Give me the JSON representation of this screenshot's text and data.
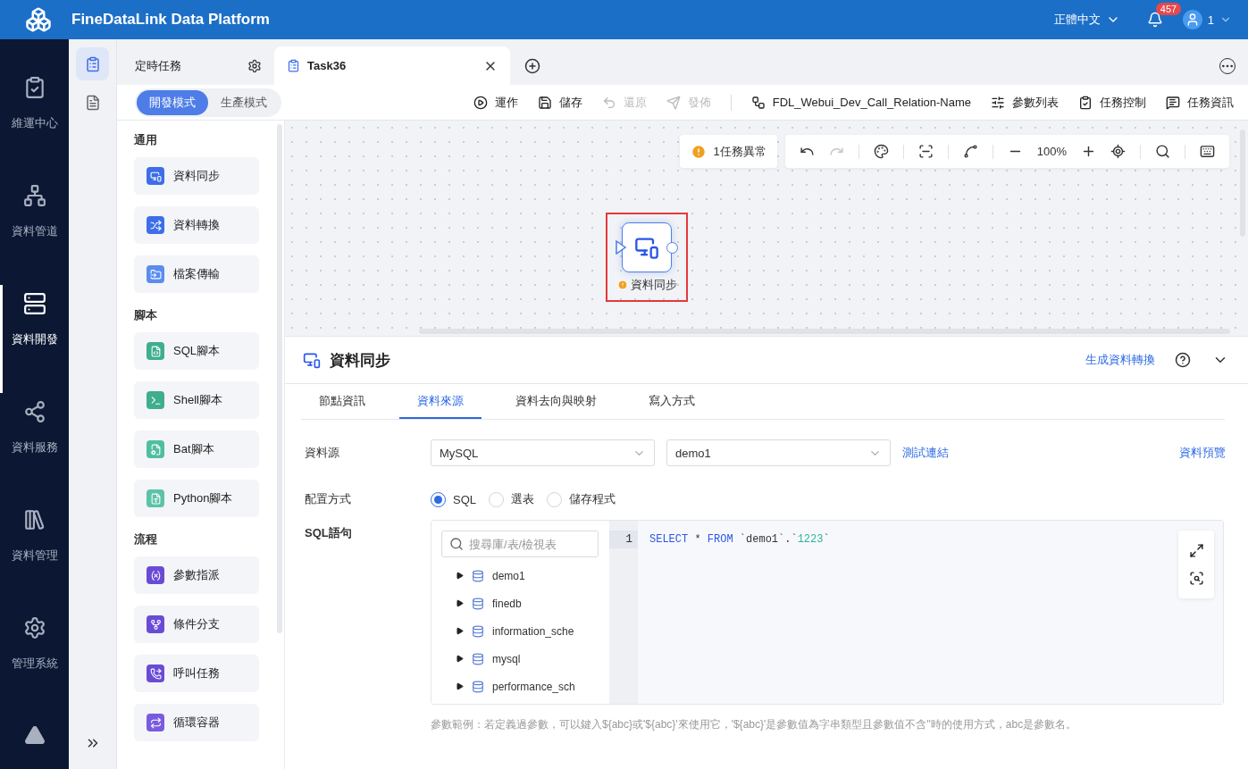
{
  "header": {
    "title": "FineDataLink Data Platform",
    "language": "正體中文",
    "notifications": "457",
    "user": "1"
  },
  "nav": {
    "items": [
      {
        "label": "維運中心",
        "selected": false
      },
      {
        "label": "資料管道",
        "selected": false
      },
      {
        "label": "資料開發",
        "selected": true
      },
      {
        "label": "資料服務",
        "selected": false
      },
      {
        "label": "資料管理",
        "selected": false
      },
      {
        "label": "管理系統",
        "selected": false
      }
    ]
  },
  "side_icons": [
    {
      "selected": true
    },
    {
      "selected": false
    }
  ],
  "tabs": [
    {
      "label": "定時任務",
      "kind": "settings",
      "selected": false
    },
    {
      "label": "Task36",
      "kind": "task",
      "selected": true
    }
  ],
  "modes": [
    {
      "label": "開發模式",
      "selected": true
    },
    {
      "label": "生產模式",
      "selected": false
    }
  ],
  "edit_actions": [
    {
      "label": "運作",
      "disabled": false
    },
    {
      "label": "儲存",
      "disabled": false
    },
    {
      "label": "還原",
      "disabled": true
    },
    {
      "label": "發佈",
      "disabled": true
    }
  ],
  "task_actions": [
    {
      "label": "FDL_Webui_Dev_Call_Relation-Name"
    },
    {
      "label": "參數列表"
    },
    {
      "label": "任務控制"
    },
    {
      "label": "任務資訊"
    }
  ],
  "palette": [
    {
      "title": "通用",
      "items": [
        "資料同步",
        "資料轉換",
        "檔案傳輸"
      ]
    },
    {
      "title": "腳本",
      "items": [
        "SQL腳本",
        "Shell腳本",
        "Bat腳本",
        "Python腳本"
      ]
    },
    {
      "title": "流程",
      "items": [
        "參數指派",
        "條件分支",
        "呼叫任務",
        "循環容器"
      ]
    }
  ],
  "canvas": {
    "alert": "1任務異常",
    "undo_redo": [
      {
        "disabled": false
      },
      {
        "disabled": true
      }
    ],
    "zoom": "100%",
    "node": {
      "label": "資料同步",
      "warning": true,
      "selected": true
    }
  },
  "panel": {
    "title": "資料同步",
    "link": "生成資料轉換",
    "tabs": [
      {
        "label": "節點資訊",
        "selected": false
      },
      {
        "label": "資料來源",
        "selected": true
      },
      {
        "label": "資料去向與映射",
        "selected": false
      },
      {
        "label": "寫入方式",
        "selected": false
      }
    ],
    "source": {
      "label": "資料源",
      "type": "MySQL",
      "database": "demo1",
      "test_link": "測試連結",
      "preview_link": "資料預覽"
    },
    "config": {
      "label": "配置方式",
      "options": [
        {
          "label": "SQL",
          "selected": true
        },
        {
          "label": "選表",
          "selected": false
        },
        {
          "label": "儲存程式",
          "selected": false
        }
      ]
    },
    "sql": {
      "label": "SQL語句",
      "search_placeholder": "搜尋庫/表/檢視表",
      "tree": [
        {
          "name": "demo1",
          "expanded": false
        },
        {
          "name": "finedb",
          "expanded": false
        },
        {
          "name": "information_sche",
          "expanded": false
        },
        {
          "name": "mysql",
          "expanded": false
        },
        {
          "name": "performance_sch",
          "expanded": false
        }
      ],
      "lines": [
        {
          "number": "1",
          "tokens": [
            {
              "text": "SELECT",
              "kind": "keyword"
            },
            {
              "text": " * ",
              "kind": "plain"
            },
            {
              "text": "FROM",
              "kind": "keyword"
            },
            {
              "text": " `demo1`.`",
              "kind": "plain"
            },
            {
              "text": "1223",
              "kind": "string"
            },
            {
              "text": "`",
              "kind": "plain"
            }
          ]
        }
      ]
    },
    "hint": "參數範例：若定義過參數，可以鍵入${abc}或'${abc}'來使用它，'${abc}'是參數值為字串類型且參數值不含''時的使用方式，abc是參數名。"
  }
}
